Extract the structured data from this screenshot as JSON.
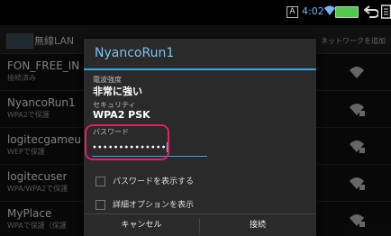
{
  "status": {
    "ime": "A",
    "time": "4:02"
  },
  "actionbar": {
    "title": "無線LAN",
    "add_network": "ネットワークを追加"
  },
  "networks": [
    {
      "name": "FON_FREE_IN",
      "security": "接続済み"
    },
    {
      "name": "NyancoRun1",
      "security": "WPA2で保護"
    },
    {
      "name": "logitecgameu",
      "security": "WEPで保護"
    },
    {
      "name": "logitecuser",
      "security": "WPA/WPA2で保護"
    },
    {
      "name": "MyPlace",
      "security": "WPAで保護（保護"
    }
  ],
  "dialog": {
    "title": "NyancoRun1",
    "signal_label": "電波強度",
    "signal_value": "非常に強い",
    "security_label": "セキュリティ",
    "security_value": "WPA2 PSK",
    "password_label": "パスワード",
    "password_value": "••••••••••••••",
    "show_password": "パスワードを表示する",
    "advanced": "詳細オプションを表示",
    "cancel": "キャンセル",
    "connect": "接続"
  },
  "colors": {
    "accent": "#2fa8e8",
    "highlight": "#e0206a"
  }
}
